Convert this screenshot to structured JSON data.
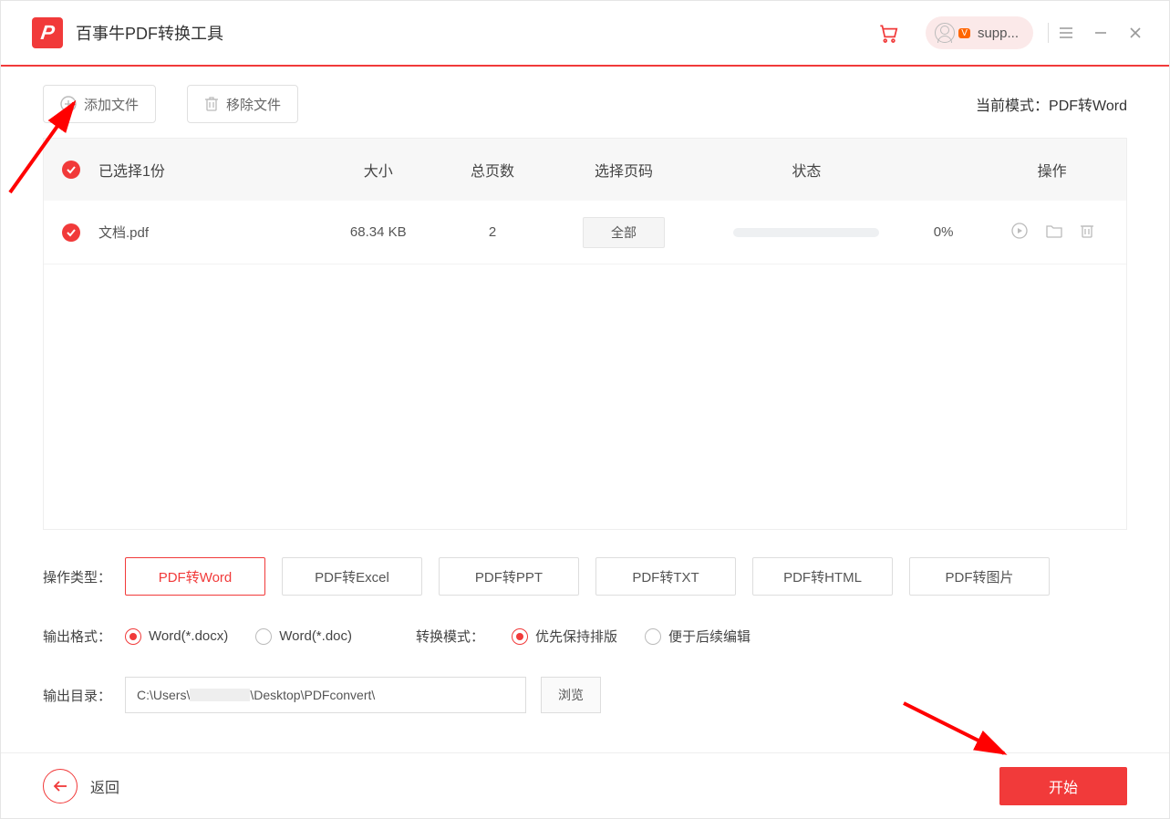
{
  "app": {
    "title": "百事牛PDF转换工具",
    "user": "supp..."
  },
  "toolbar": {
    "add": "添加文件",
    "remove": "移除文件",
    "mode_prefix": "当前模式：",
    "mode_value": "PDF转Word"
  },
  "table": {
    "headers": {
      "selected": "已选择1份",
      "size": "大小",
      "pages": "总页数",
      "range": "选择页码",
      "status": "状态",
      "ops": "操作"
    },
    "rows": [
      {
        "name": "文档.pdf",
        "size": "68.34 KB",
        "pages": "2",
        "range": "全部",
        "percent": "0%"
      }
    ]
  },
  "options": {
    "type_label": "操作类型：",
    "types": [
      "PDF转Word",
      "PDF转Excel",
      "PDF转PPT",
      "PDF转TXT",
      "PDF转HTML",
      "PDF转图片"
    ],
    "format_label": "输出格式：",
    "formats": [
      "Word(*.docx)",
      "Word(*.doc)"
    ],
    "convert_label": "转换模式：",
    "convert_opts": [
      "优先保持排版",
      "便于后续编辑"
    ],
    "dir_label": "输出目录：",
    "dir_value_a": "C:\\Users\\",
    "dir_value_b": "\\Desktop\\PDFconvert\\",
    "browse": "浏览"
  },
  "footer": {
    "back": "返回",
    "start": "开始"
  }
}
